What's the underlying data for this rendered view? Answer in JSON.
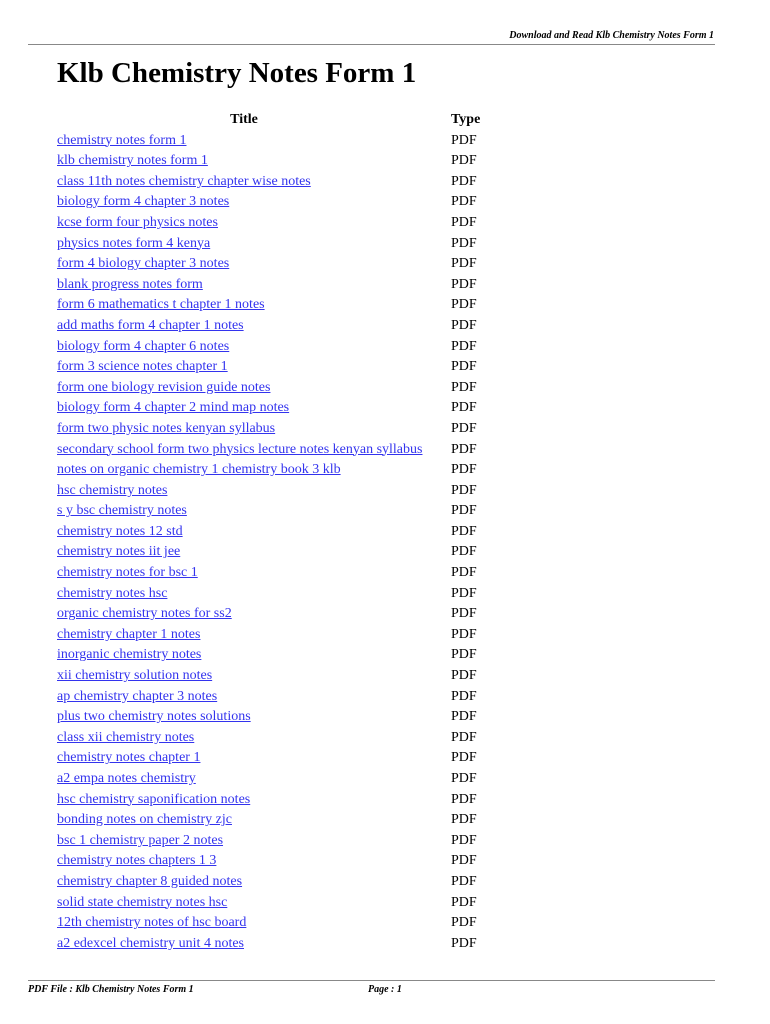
{
  "header": {
    "text": "Download and Read Klb Chemistry Notes Form 1"
  },
  "document": {
    "title": "Klb Chemistry Notes Form 1"
  },
  "table": {
    "columns": {
      "title": "Title",
      "type": "Type"
    },
    "rows": [
      {
        "title": "chemistry notes form 1",
        "type": "PDF"
      },
      {
        "title": "klb chemistry notes form 1",
        "type": "PDF"
      },
      {
        "title": "class 11th notes chemistry chapter wise notes",
        "type": "PDF"
      },
      {
        "title": "biology form 4 chapter 3 notes",
        "type": "PDF"
      },
      {
        "title": "kcse form four physics notes",
        "type": "PDF"
      },
      {
        "title": "physics notes form 4 kenya",
        "type": "PDF"
      },
      {
        "title": "form 4 biology chapter 3 notes",
        "type": "PDF"
      },
      {
        "title": "blank progress notes form",
        "type": "PDF"
      },
      {
        "title": "form 6 mathematics t chapter 1 notes",
        "type": "PDF"
      },
      {
        "title": "add maths form 4 chapter 1 notes",
        "type": "PDF"
      },
      {
        "title": "biology form 4 chapter 6 notes",
        "type": "PDF"
      },
      {
        "title": "form 3 science notes chapter 1",
        "type": "PDF"
      },
      {
        "title": "form one biology revision guide notes",
        "type": "PDF"
      },
      {
        "title": "biology form 4 chapter 2 mind map notes",
        "type": "PDF"
      },
      {
        "title": "form two physic notes kenyan syllabus",
        "type": "PDF"
      },
      {
        "title": "secondary school form two physics lecture notes kenyan syllabus",
        "type": "PDF"
      },
      {
        "title": "notes on organic chemistry 1 chemistry book 3 klb",
        "type": "PDF"
      },
      {
        "title": "hsc chemistry notes",
        "type": "PDF"
      },
      {
        "title": "s y bsc chemistry notes",
        "type": "PDF"
      },
      {
        "title": "chemistry notes 12 std",
        "type": "PDF"
      },
      {
        "title": "chemistry notes iit jee",
        "type": "PDF"
      },
      {
        "title": "chemistry notes for bsc 1",
        "type": "PDF"
      },
      {
        "title": "chemistry notes hsc",
        "type": "PDF"
      },
      {
        "title": "organic chemistry notes for ss2",
        "type": "PDF"
      },
      {
        "title": "chemistry chapter 1 notes",
        "type": "PDF"
      },
      {
        "title": "inorganic chemistry notes",
        "type": "PDF"
      },
      {
        "title": "xii chemistry solution notes",
        "type": "PDF"
      },
      {
        "title": "ap chemistry chapter 3 notes",
        "type": "PDF"
      },
      {
        "title": "plus two chemistry notes solutions",
        "type": "PDF"
      },
      {
        "title": "class xii chemistry notes",
        "type": "PDF"
      },
      {
        "title": "chemistry notes chapter 1",
        "type": "PDF"
      },
      {
        "title": "a2 empa notes chemistry",
        "type": "PDF"
      },
      {
        "title": "hsc chemistry saponification notes",
        "type": "PDF"
      },
      {
        "title": "bonding notes on chemistry zjc",
        "type": "PDF"
      },
      {
        "title": "bsc 1 chemistry paper 2 notes",
        "type": "PDF"
      },
      {
        "title": "chemistry notes chapters 1 3",
        "type": "PDF"
      },
      {
        "title": "chemistry chapter 8 guided notes",
        "type": "PDF"
      },
      {
        "title": "solid state chemistry notes hsc",
        "type": "PDF"
      },
      {
        "title": "12th chemistry notes of hsc board",
        "type": "PDF"
      },
      {
        "title": "a2 edexcel chemistry unit 4 notes",
        "type": "PDF"
      }
    ]
  },
  "footer": {
    "file_label": "PDF File : Klb Chemistry Notes Form 1",
    "page_label": "Page : 1"
  },
  "colors": {
    "link": "#3333ee",
    "rule": "#888888"
  }
}
